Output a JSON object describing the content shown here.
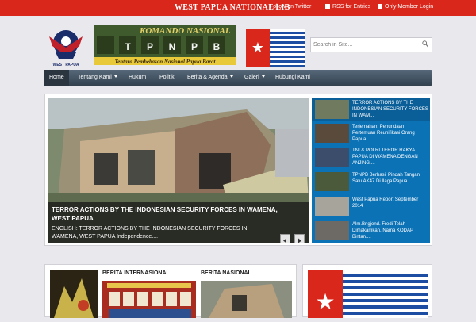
{
  "topbar": {
    "site_title": "WEST PAPUA NATIONAL LIB",
    "follow_twitter": "Follow on Twitter",
    "rss": "RSS for Entries",
    "member_login": "Only Member Login"
  },
  "logo": {
    "main": "KOMANDO NASIONAL",
    "letters": [
      "T",
      "P",
      "N",
      "P",
      "B"
    ],
    "subtitle": "Tentara Pembebasan Nasional Papua Barat",
    "emblem_caption": "WEST PAPUA"
  },
  "search": {
    "placeholder": "Search in Site..."
  },
  "nav": {
    "items": [
      {
        "label": "Home"
      },
      {
        "label": "Tentang Kami"
      },
      {
        "label": "Hukum"
      },
      {
        "label": "Politik"
      },
      {
        "label": "Berita & Agenda"
      },
      {
        "label": "Galeri"
      },
      {
        "label": "Hubungi Kami"
      }
    ]
  },
  "slider": {
    "title": "TERROR ACTIONS BY THE INDONESIAN SECURITY FORCES IN WAMENA, WEST PAPUA",
    "excerpt": "ENGLISH: TERROR ACTIONS BY THE INDONESIAN SECURITY FORCES IN WAMENA, WEST PAPUA Independence....",
    "prev": "◀",
    "next": "▶",
    "thumbs": [
      {
        "text": "TERROR ACTIONS BY THE INDONESIAN SECURITY FORCES IN WAM..."
      },
      {
        "text": "Terjemahan: Penundaan Pertemuan Reunifikasi Orang Papua...."
      },
      {
        "text": "TNI & POLRI TEROR RAKYAT PAPUA DI WAMENA DENGAN ANJING...."
      },
      {
        "text": "TPNPB Berhasil Pindah Tangan Satu AK47 Di Ilaga Papua"
      },
      {
        "text": "West Papua Report September 2014"
      },
      {
        "text": "Alm.Brigjend. Fredi Telah Dimakamkan, Nama KODAP Bintan...."
      }
    ]
  },
  "sections": {
    "internasional": "BERITA INTERNASIONAL",
    "nasional": "BERITA NASIONAL"
  },
  "colors": {
    "topbar": "#d9271c",
    "nav": "#3b4a58",
    "thumbs": "#0b72b6",
    "flag_blue": "#1c4da3",
    "flag_red": "#d9271c"
  }
}
